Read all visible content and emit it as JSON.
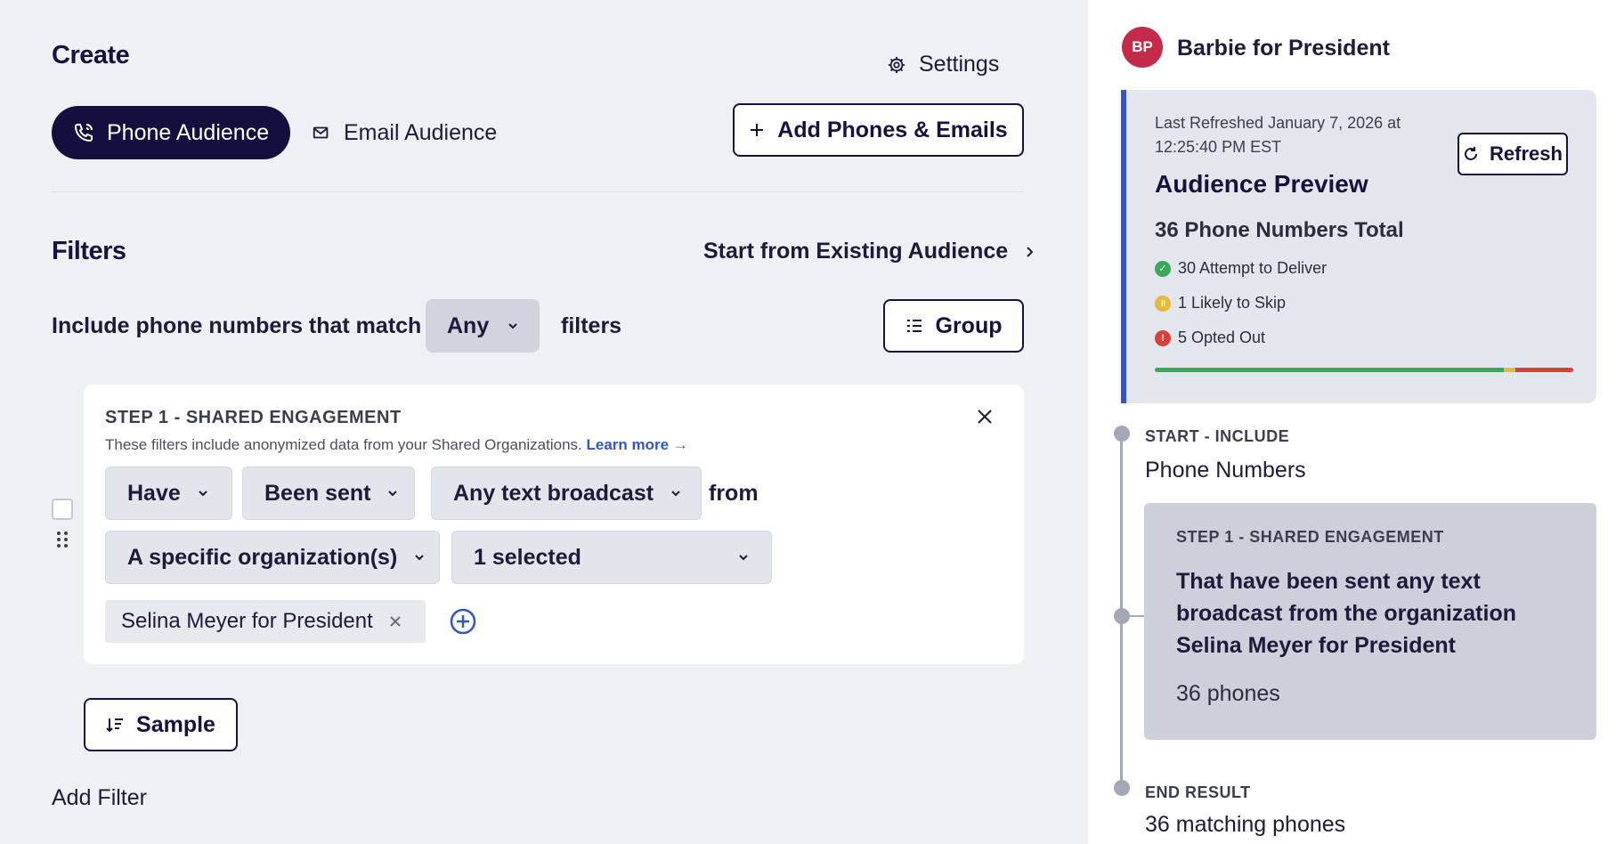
{
  "header": {
    "title": "Create",
    "settings_label": "Settings"
  },
  "audience_tabs": [
    {
      "label": "Phone Audience",
      "active": true
    },
    {
      "label": "Email Audience",
      "active": false
    }
  ],
  "add_button_label": "Add Phones & Emails",
  "filters": {
    "title": "Filters",
    "start_existing_label": "Start from Existing Audience",
    "include_prefix": "Include phone numbers that match",
    "match_mode": "Any",
    "include_suffix": "filters",
    "group_label": "Group"
  },
  "step1": {
    "title": "STEP 1 - SHARED ENGAGEMENT",
    "description": "These filters include anonymized data from your Shared Organizations.",
    "learn_more": "Learn more →",
    "have": "Have",
    "action": "Been sent",
    "content": "Any text broadcast",
    "from_text": "from",
    "source": "A specific organization(s)",
    "selected": "1 selected",
    "chip": "Selina Meyer for President"
  },
  "sample_label": "Sample",
  "add_filter_label": "Add Filter",
  "org": {
    "initials": "BP",
    "name": "Barbie for President",
    "avatar_color": "#c42b4b"
  },
  "preview": {
    "last_refreshed": "Last Refreshed January 7, 2026 at 12:25:40 PM EST",
    "refresh_label": "Refresh",
    "title": "Audience Preview",
    "total": "36 Phone Numbers Total",
    "stats": [
      {
        "label": "30 Attempt to Deliver",
        "color": "#3aa75a",
        "value": 30
      },
      {
        "label": "1 Likely to Skip",
        "color": "#e7b83a",
        "value": 1
      },
      {
        "label": "5 Opted Out",
        "color": "#d6413b",
        "value": 5
      }
    ]
  },
  "timeline": {
    "start_label": "START - INCLUDE",
    "start_value": "Phone Numbers",
    "step_label": "STEP 1 - SHARED ENGAGEMENT",
    "step_text": "That have been sent any text broadcast from the organization Selina Meyer for President",
    "step_count": "36 phones",
    "end_label": "END RESULT",
    "end_value": "36 matching phones"
  }
}
